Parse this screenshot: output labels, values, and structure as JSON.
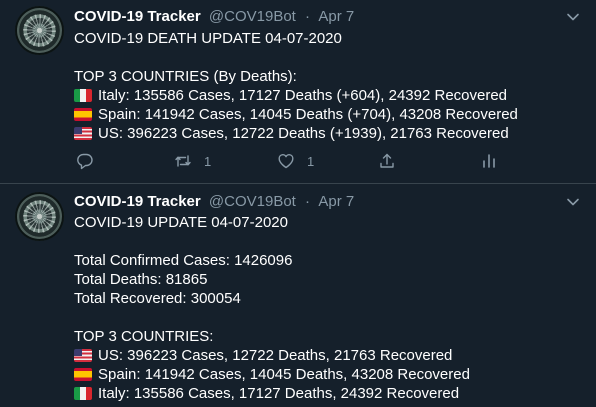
{
  "tweets": [
    {
      "author_name": "COVID-19 Tracker",
      "author_handle": "@COV19Bot",
      "separator": "·",
      "date": "Apr 7",
      "title_line": "COVID-19 DEATH UPDATE 04-07-2020",
      "list_heading": "TOP 3 COUNTRIES (By Deaths):",
      "countries": [
        {
          "flag": "italy-flag-icon",
          "text": "Italy: 135586 Cases, 17127 Deaths (+604), 24392 Recovered"
        },
        {
          "flag": "spain-flag-icon",
          "text": "Spain: 141942 Cases, 14045 Deaths (+704), 43208 Recovered"
        },
        {
          "flag": "us-flag-icon",
          "text": "US: 396223 Cases, 12722 Deaths (+1939), 21763 Recovered"
        }
      ],
      "actions": {
        "retweet_count": "1",
        "like_count": "1"
      }
    },
    {
      "author_name": "COVID-19 Tracker",
      "author_handle": "@COV19Bot",
      "separator": "·",
      "date": "Apr 7",
      "title_line": "COVID-19 UPDATE 04-07-2020",
      "totals": [
        "Total Confirmed Cases: 1426096",
        "Total Deaths: 81865",
        "Total Recovered: 300054"
      ],
      "list_heading": "TOP 3 COUNTRIES:",
      "countries": [
        {
          "flag": "us-flag-icon",
          "text": "US: 396223 Cases, 12722 Deaths, 21763 Recovered"
        },
        {
          "flag": "spain-flag-icon",
          "text": "Spain: 141942 Cases, 14045 Deaths, 43208 Recovered"
        },
        {
          "flag": "italy-flag-icon",
          "text": "Italy: 135586 Cases, 17127 Deaths, 24392 Recovered"
        }
      ]
    }
  ],
  "colors": {
    "background": "#15202b",
    "divider": "#38444d",
    "secondary_text": "#8899a6",
    "primary_text": "#ffffff"
  }
}
